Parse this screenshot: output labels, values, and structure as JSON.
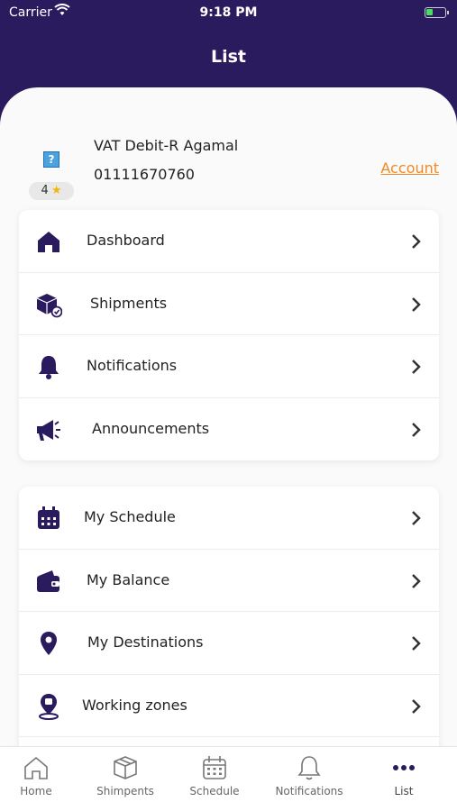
{
  "status_bar": {
    "carrier": "Carrier",
    "time": "9:18 PM"
  },
  "header": {
    "title": "List"
  },
  "profile": {
    "rating": "4",
    "name": "VAT Debit-R Agamal",
    "phone": "01111670760",
    "account_link": "Account"
  },
  "menu_group_1": [
    {
      "label": "Dashboard",
      "icon": "home-icon"
    },
    {
      "label": "Shipments",
      "icon": "package-icon"
    },
    {
      "label": "Notifications",
      "icon": "bell-icon"
    },
    {
      "label": "Announcements",
      "icon": "megaphone-icon"
    }
  ],
  "menu_group_2": [
    {
      "label": "My Schedule",
      "icon": "calendar-icon"
    },
    {
      "label": "My Balance",
      "icon": "wallet-icon"
    },
    {
      "label": "My Destinations",
      "icon": "location-pin-icon"
    },
    {
      "label": "Working zones",
      "icon": "zone-pin-icon"
    }
  ],
  "tab_bar": {
    "tabs": [
      {
        "label": "Home",
        "icon": "home-outline-icon"
      },
      {
        "label": "Shimpents",
        "icon": "box-outline-icon"
      },
      {
        "label": "Schedule",
        "icon": "calendar-outline-icon"
      },
      {
        "label": "Notifications",
        "icon": "bell-outline-icon"
      },
      {
        "label": "List",
        "icon": "more-dots-icon"
      }
    ],
    "active": "List"
  },
  "colors": {
    "header_bg": "#2a1a5e",
    "icon_color": "#2a1a5e",
    "account_link": "#f08a24",
    "rating_star": "#f5b800"
  }
}
